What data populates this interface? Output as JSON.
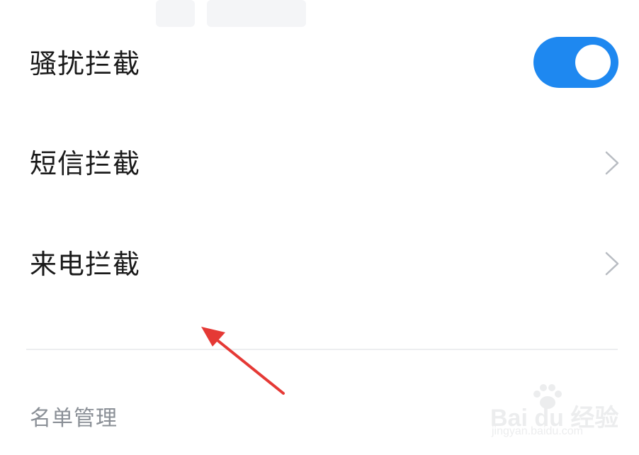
{
  "settings": {
    "items": [
      {
        "label": "骚扰拦截",
        "control": "toggle",
        "enabled": true
      },
      {
        "label": "短信拦截",
        "control": "chevron"
      },
      {
        "label": "来电拦截",
        "control": "chevron"
      }
    ]
  },
  "sections": {
    "list_management_title": "名单管理"
  },
  "watermark": {
    "logo": "Bai du 经验",
    "url": "jingyan.baidu.com"
  },
  "colors": {
    "toggle_on": "#1e88f0",
    "annotation_arrow": "#e53935",
    "text_primary": "#1a1a1a",
    "text_secondary": "#8a8f96"
  },
  "icons": {
    "chevron": "chevron-right-icon",
    "annotation": "red-arrow-icon"
  }
}
